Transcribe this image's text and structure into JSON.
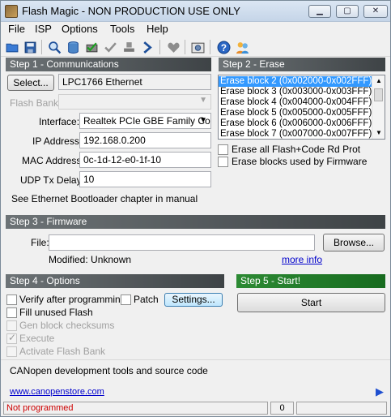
{
  "window": {
    "title": "Flash Magic - NON PRODUCTION USE ONLY",
    "controls": [
      "minimize",
      "maximize",
      "close"
    ]
  },
  "menu": [
    "File",
    "ISP",
    "Options",
    "Tools",
    "Help"
  ],
  "toolbar_icons": [
    "open-folder-icon",
    "save-icon",
    "search-icon",
    "database-icon",
    "program-icon",
    "checkmark-icon",
    "stamp-icon",
    "go-arrow-icon",
    "heart-icon",
    "camera-icon",
    "help-icon",
    "people-icon"
  ],
  "step1": {
    "header": "Step 1 - Communications",
    "select_label": "Select...",
    "device": "LPC1766 Ethernet",
    "flash_bank_label": "Flash Bank:",
    "interface_label": "Interface:",
    "interface_value": "Realtek PCIe GBE Family Cor",
    "ip_label": "IP Address:",
    "ip_value": "192.168.0.200",
    "mac_label": "MAC Address:",
    "mac_value": "0c-1d-12-e0-1f-10",
    "udp_label": "UDP Tx Delay:",
    "udp_value": "10",
    "note": "See Ethernet Bootloader chapter in manual"
  },
  "step2": {
    "header": "Step 2 - Erase",
    "blocks": [
      "Erase block 2 (0x002000-0x002FFF)",
      "Erase block 3 (0x003000-0x003FFF)",
      "Erase block 4 (0x004000-0x004FFF)",
      "Erase block 5 (0x005000-0x005FFF)",
      "Erase block 6 (0x006000-0x006FFF)",
      "Erase block 7 (0x007000-0x007FFF)"
    ],
    "selected_index": 0,
    "erase_all_label": "Erase all Flash+Code Rd Prot",
    "erase_used_label": "Erase blocks used by Firmware"
  },
  "step3": {
    "header": "Step 3 - Firmware",
    "file_label": "File:",
    "file_value": "",
    "browse_label": "Browse...",
    "modified_text": "Modified: Unknown",
    "more_info": "more info"
  },
  "step4": {
    "header": "Step 4 - Options",
    "verify_label": "Verify after programming",
    "patch_label": "Patch",
    "settings_label": "Settings...",
    "fill_label": "Fill unused Flash",
    "gen_label": "Gen block checksums",
    "execute_label": "Execute",
    "activate_label": "Activate Flash Bank"
  },
  "step5": {
    "header": "Step 5 - Start!",
    "start_label": "Start"
  },
  "footer": {
    "promo": "CANopen development tools and source code",
    "url": "www.canopenstore.com"
  },
  "status": {
    "text": "Not programmed",
    "count": "0",
    "progress": 0
  },
  "colors": {
    "status_text": "#cc0000",
    "section_header": "#4a5053",
    "step5_header": "#1f7a26",
    "selection": "#3399ff",
    "link": "#0000cc"
  }
}
